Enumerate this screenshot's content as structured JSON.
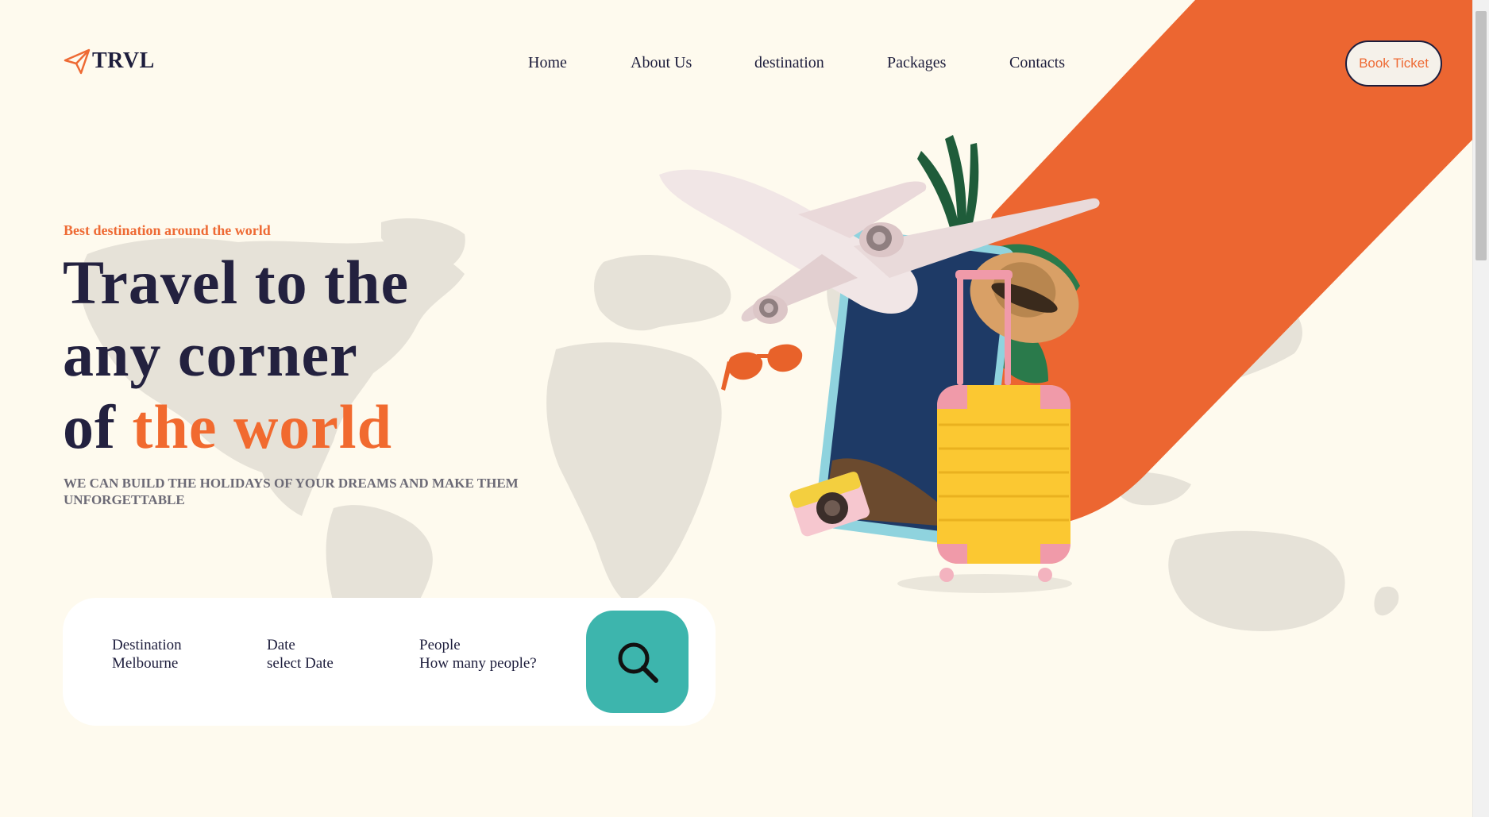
{
  "brand": {
    "name": "TRVL",
    "icon": "paper-plane-icon",
    "accent_color": "#ee6a34",
    "teal_color": "#3db5ad",
    "dark_color": "#1d1d3c",
    "background_color": "#fefaee"
  },
  "nav": {
    "items": [
      {
        "label": "Home"
      },
      {
        "label": "About Us"
      },
      {
        "label": "destination"
      },
      {
        "label": "Packages"
      },
      {
        "label": "Contacts"
      }
    ],
    "cta_label": "Book Ticket"
  },
  "hero": {
    "tagline": "Best destination around the world",
    "headline_line1": "Travel to the",
    "headline_line2": "any corner",
    "headline_line3_prefix": "of ",
    "headline_line3_accent": "the world",
    "subtitle": "WE CAN BUILD THE HOLIDAYS OF YOUR DREAMS AND MAKE THEM UNFORGETTABLE"
  },
  "search": {
    "fields": [
      {
        "label": "Destination",
        "value": "Melbourne"
      },
      {
        "label": "Date",
        "value": "select Date"
      },
      {
        "label": "People",
        "value": "How many people?"
      }
    ],
    "button_icon": "search-icon"
  }
}
